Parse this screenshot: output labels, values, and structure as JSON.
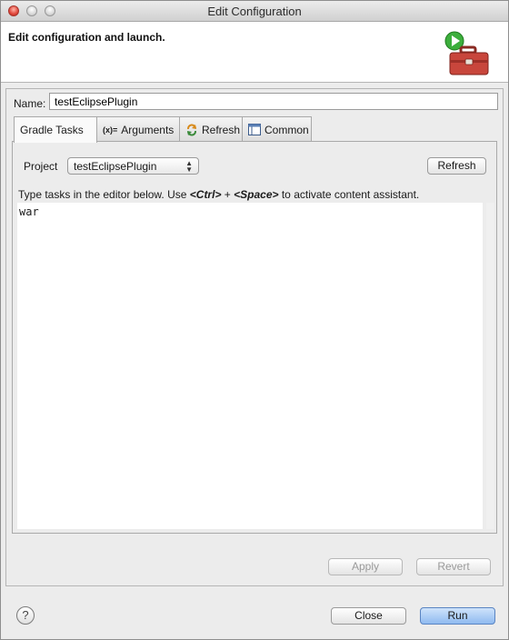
{
  "window": {
    "title": "Edit Configuration"
  },
  "banner": {
    "title": "Edit configuration and launch."
  },
  "name": {
    "label": "Name:",
    "value": "testEclipsePlugin"
  },
  "tabs": [
    {
      "label": "Gradle Tasks",
      "icon": "none"
    },
    {
      "label": "Arguments",
      "icon": "variable-icon"
    },
    {
      "label": "Refresh",
      "icon": "refresh-icon"
    },
    {
      "label": "Common",
      "icon": "common-icon"
    }
  ],
  "gradle_tasks": {
    "project_label": "Project",
    "project_value": "testEclipsePlugin",
    "refresh_button": "Refresh",
    "hint_prefix": "Type tasks in the editor below. Use ",
    "hint_key1": "<Ctrl>",
    "hint_plus": " + ",
    "hint_key2": "<Space>",
    "hint_suffix": " to activate content assistant.",
    "editor_text": "war"
  },
  "buttons": {
    "apply": "Apply",
    "revert": "Revert",
    "close": "Close",
    "run": "Run",
    "help": "?"
  },
  "colors": {
    "run_accent": "#8fbaf0",
    "banner_green": "#3cae3c",
    "toolbox_red": "#c8463c"
  }
}
